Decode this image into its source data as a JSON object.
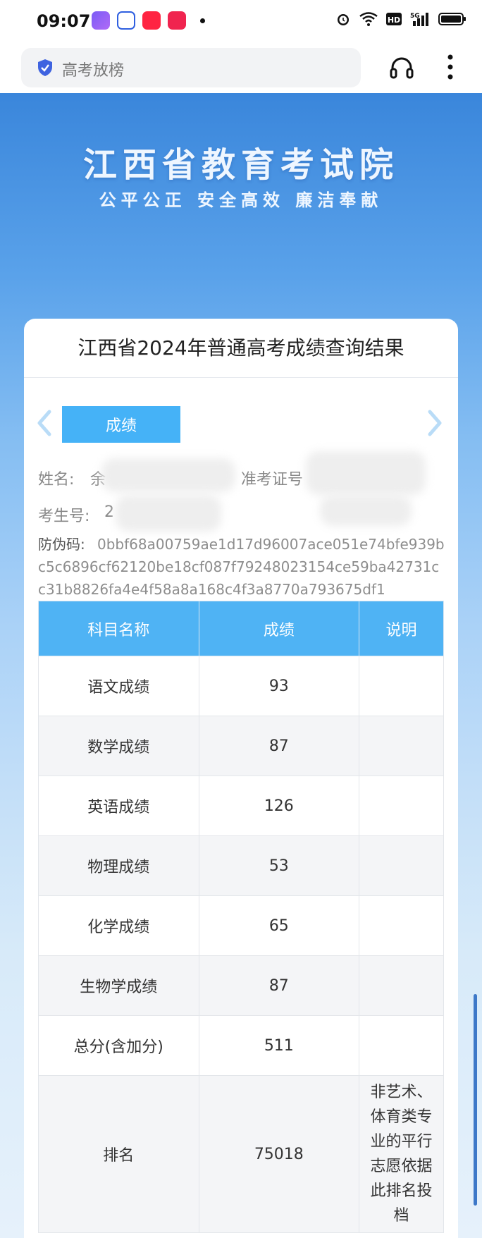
{
  "status_bar": {
    "time": "09:07",
    "app_icons": [
      "cloud-app-icon",
      "baidu-app-icon",
      "redbook-app-icon",
      "video-app-icon"
    ],
    "right_icons": [
      "alarm-icon",
      "wifi-icon",
      "hd-icon",
      "5g-signal-icon",
      "battery-icon"
    ]
  },
  "browser": {
    "url_text": "高考放榜"
  },
  "hero": {
    "title": "江西省教育考试院",
    "slogan": "公平公正 安全高效 廉洁奉献"
  },
  "card": {
    "title": "江西省2024年普通高考成绩查询结果",
    "tab_label": "成绩",
    "name_label": "姓名:",
    "name_value": "余",
    "ticket_label": "准考证号",
    "exam_no_label": "考生号:",
    "exam_no_value": "2",
    "anti_fake_label": "防伪码:",
    "anti_fake_code": "0bbf68a00759ae1d17d96007ace051e74bfe939bc5c6896cf62120be18cf087f79248023154ce59ba42731cc31b8826fa4e4f58a8a168c4f3a8770a793675df1"
  },
  "table": {
    "headers": [
      "科目名称",
      "成绩",
      "说明"
    ],
    "rows": [
      {
        "subject": "语文成绩",
        "score": "93",
        "note": ""
      },
      {
        "subject": "数学成绩",
        "score": "87",
        "note": ""
      },
      {
        "subject": "英语成绩",
        "score": "126",
        "note": ""
      },
      {
        "subject": "物理成绩",
        "score": "53",
        "note": ""
      },
      {
        "subject": "化学成绩",
        "score": "65",
        "note": ""
      },
      {
        "subject": "生物学成绩",
        "score": "87",
        "note": ""
      },
      {
        "subject": "总分(含加分)",
        "score": "511",
        "note": ""
      },
      {
        "subject": "排名",
        "score": "75018",
        "note": "非艺术、体育类专业的平行志愿依据此排名投档"
      }
    ]
  },
  "colors": {
    "header_blue": "#4fb3f4",
    "tab_blue": "#45b2f7",
    "hero_blue": "#3a86db"
  }
}
